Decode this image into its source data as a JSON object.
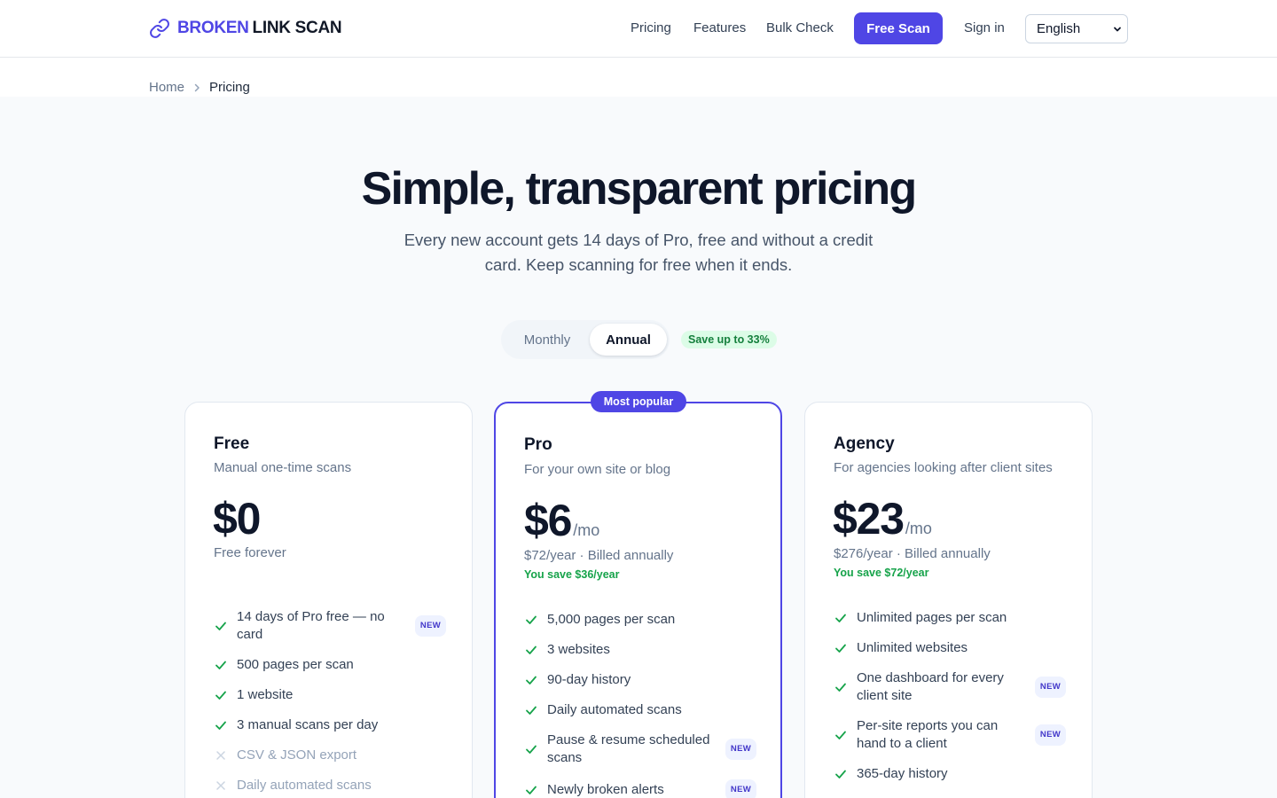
{
  "brand": {
    "part1": "BROKEN",
    "part2": "LINK SCAN",
    "icon": "link-icon"
  },
  "nav": {
    "links": [
      "Pricing",
      "Features",
      "Bulk Check"
    ],
    "cta": "Free Scan",
    "sign_in": "Sign in",
    "language": "English"
  },
  "breadcrumb": {
    "home": "Home",
    "current": "Pricing"
  },
  "hero": {
    "title": "Simple, transparent pricing",
    "subtitle": "Every new account gets 14 days of Pro, free and without a credit card. Keep scanning for free when it ends."
  },
  "billing_toggle": {
    "monthly": "Monthly",
    "annual": "Annual",
    "selected": "Annual",
    "savings_badge": "Save up to 33%"
  },
  "colors": {
    "accent": "#4f46e5",
    "success": "#16a34a",
    "muted": "#64748b"
  },
  "plans": [
    {
      "name": "Free",
      "description": "Manual one-time scans",
      "price": "$0",
      "unit": "",
      "note": "Free forever",
      "savings": "",
      "features": [
        {
          "text": "14 days of Pro free — no card",
          "included": true,
          "badge": "NEW"
        },
        {
          "text": "500 pages per scan",
          "included": true,
          "badge": ""
        },
        {
          "text": "1 website",
          "included": true,
          "badge": ""
        },
        {
          "text": "3 manual scans per day",
          "included": true,
          "badge": ""
        },
        {
          "text": "CSV & JSON export",
          "included": false,
          "badge": ""
        },
        {
          "text": "Daily automated scans",
          "included": false,
          "badge": ""
        }
      ]
    },
    {
      "name": "Pro",
      "badge": "Most popular",
      "description": "For your own site or blog",
      "price": "$6",
      "unit": "/mo",
      "note": "$72/year · Billed annually",
      "savings": "You save $36/year",
      "features": [
        {
          "text": "5,000 pages per scan",
          "included": true,
          "badge": ""
        },
        {
          "text": "3 websites",
          "included": true,
          "badge": ""
        },
        {
          "text": "90-day history",
          "included": true,
          "badge": ""
        },
        {
          "text": "Daily automated scans",
          "included": true,
          "badge": ""
        },
        {
          "text": "Pause & resume scheduled scans",
          "included": true,
          "badge": "NEW"
        },
        {
          "text": "Newly broken alerts",
          "included": true,
          "badge": "NEW"
        }
      ]
    },
    {
      "name": "Agency",
      "description": "For agencies looking after client sites",
      "price": "$23",
      "unit": "/mo",
      "note": "$276/year · Billed annually",
      "savings": "You save $72/year",
      "features": [
        {
          "text": "Unlimited pages per scan",
          "included": true,
          "badge": ""
        },
        {
          "text": "Unlimited websites",
          "included": true,
          "badge": ""
        },
        {
          "text": "One dashboard for every client site",
          "included": true,
          "badge": "NEW"
        },
        {
          "text": "Per-site reports you can hand to a client",
          "included": true,
          "badge": "NEW"
        },
        {
          "text": "365-day history",
          "included": true,
          "badge": ""
        }
      ]
    }
  ]
}
